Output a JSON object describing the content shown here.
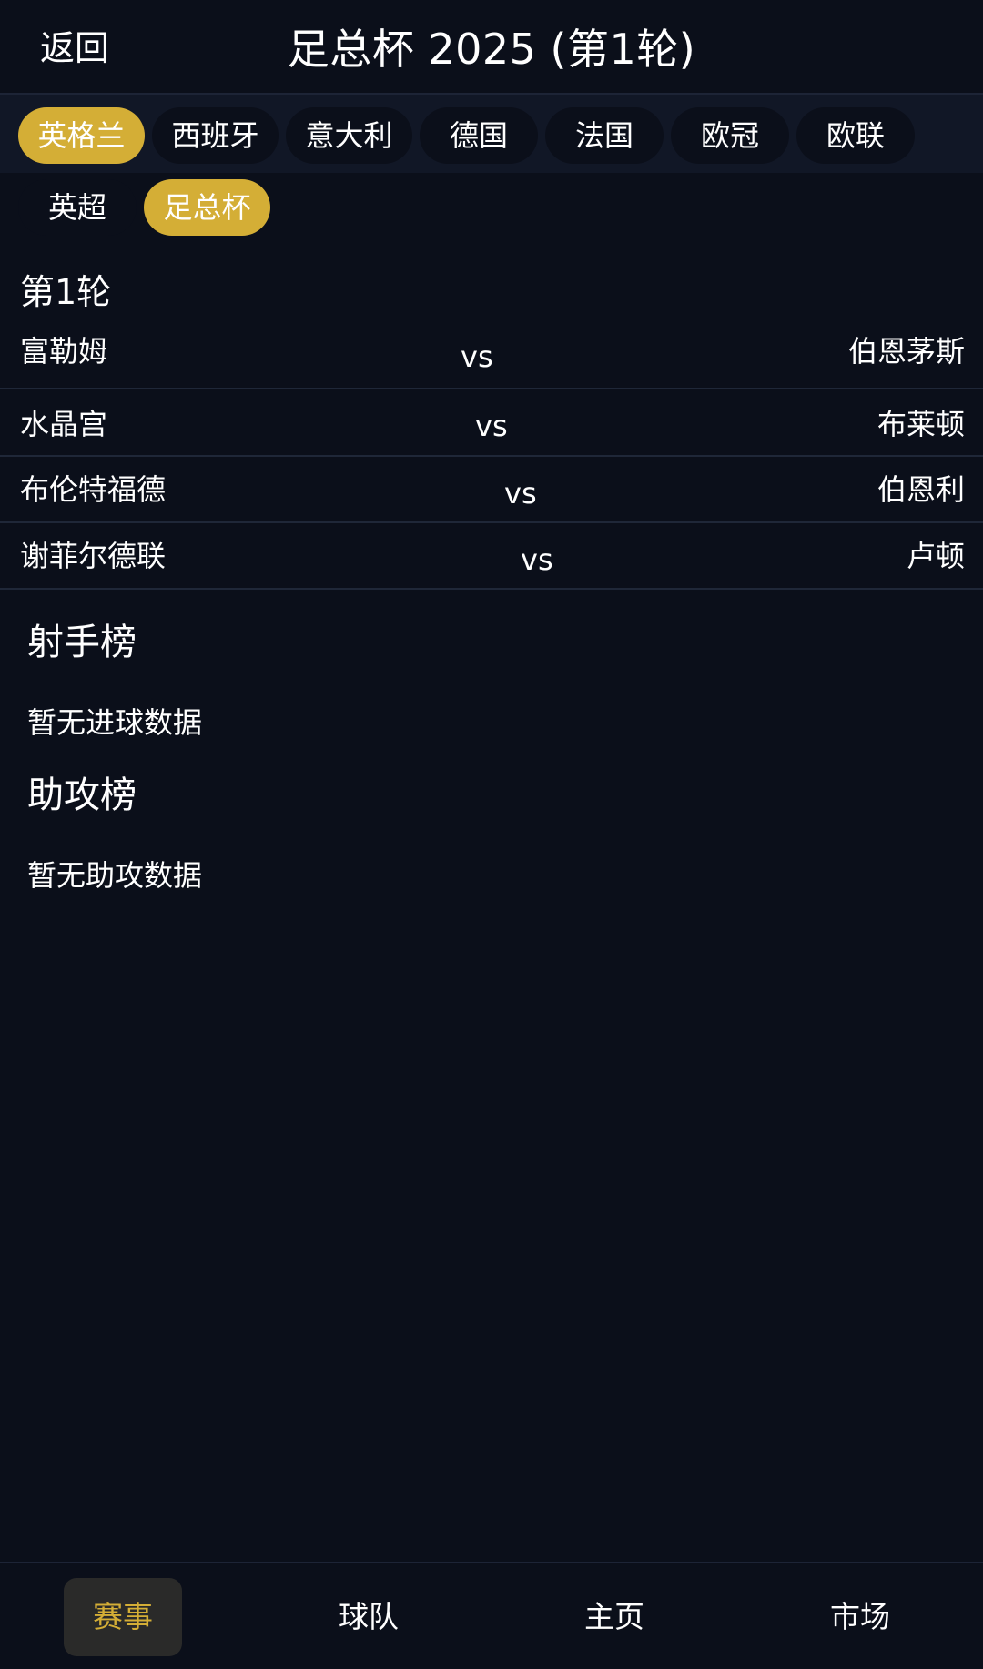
{
  "header": {
    "back_label": "返回",
    "title": "足总杯 2025 (第1轮)"
  },
  "country_tabs": [
    {
      "label": "英格兰",
      "active": true
    },
    {
      "label": "西班牙",
      "active": false
    },
    {
      "label": "意大利",
      "active": false
    },
    {
      "label": "德国",
      "active": false
    },
    {
      "label": "法国",
      "active": false
    },
    {
      "label": "欧冠",
      "active": false
    },
    {
      "label": "欧联",
      "active": false
    }
  ],
  "league_tabs": [
    {
      "label": "英超",
      "active": false
    },
    {
      "label": "足总杯",
      "active": true
    }
  ],
  "round": {
    "title": "第1轮",
    "fixtures": [
      {
        "home": "富勒姆",
        "vs": "vs",
        "away": "伯恩茅斯"
      },
      {
        "home": "水晶宫",
        "vs": "vs",
        "away": "布莱顿"
      },
      {
        "home": "布伦特福德",
        "vs": "vs",
        "away": "伯恩利"
      },
      {
        "home": "谢菲尔德联",
        "vs": "vs",
        "away": "卢顿"
      }
    ]
  },
  "scorers": {
    "title": "射手榜",
    "empty": "暂无进球数据"
  },
  "assists": {
    "title": "助攻榜",
    "empty": "暂无助攻数据"
  },
  "bottom_nav": [
    {
      "label": "赛事",
      "active": true
    },
    {
      "label": "球队",
      "active": false
    },
    {
      "label": "主页",
      "active": false
    },
    {
      "label": "市场",
      "active": false
    }
  ],
  "colors": {
    "background": "#0b0f1a",
    "accent": "#d4ae36",
    "tab_strip": "#111726"
  }
}
